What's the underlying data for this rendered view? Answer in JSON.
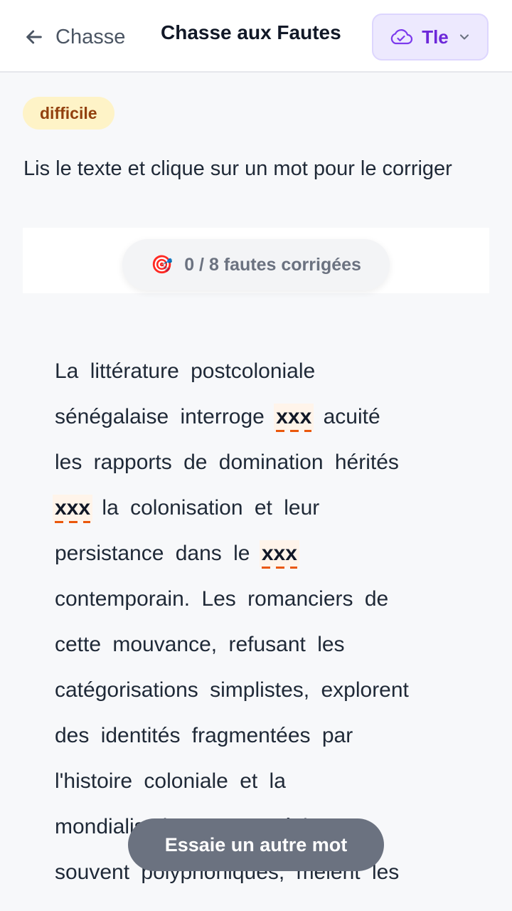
{
  "header": {
    "back_label": "Chasse",
    "title": "Chasse aux Fautes",
    "level": "Tle"
  },
  "badge": "difficile",
  "instruction": "Lis le texte et clique sur un mot pour le corriger",
  "counter": {
    "emoji": "🎯",
    "text": "0 / 8 fautes corrigées"
  },
  "passage": {
    "l1": "La littérature postcoloniale",
    "l2a": "sénégalaise interroge",
    "e1": "xxx",
    "l2b": "acuité",
    "l3": "les rapports de domination hérités",
    "e2": "xxx",
    "l4b": "la colonisation et leur",
    "l5a": "persistance dans le",
    "e3": "xxx",
    "l6": "contemporain. Les romanciers de",
    "l7": "cette mouvance, refusant les",
    "l8": "catégorisations simplistes, explorent",
    "l9": "des identités fragmentées par",
    "l10": "l'histoire coloniale et la",
    "l11": "mondialisation et, en récits",
    "l12": "souvent polyphoniques, mêlent les"
  },
  "toast": "Essaie un autre mot",
  "colors": {
    "accent": "#6d28d9",
    "badge_bg": "#fef3c7",
    "badge_text": "#92400e",
    "error_underline": "#ea580c",
    "toast_bg": "#6b7280"
  }
}
